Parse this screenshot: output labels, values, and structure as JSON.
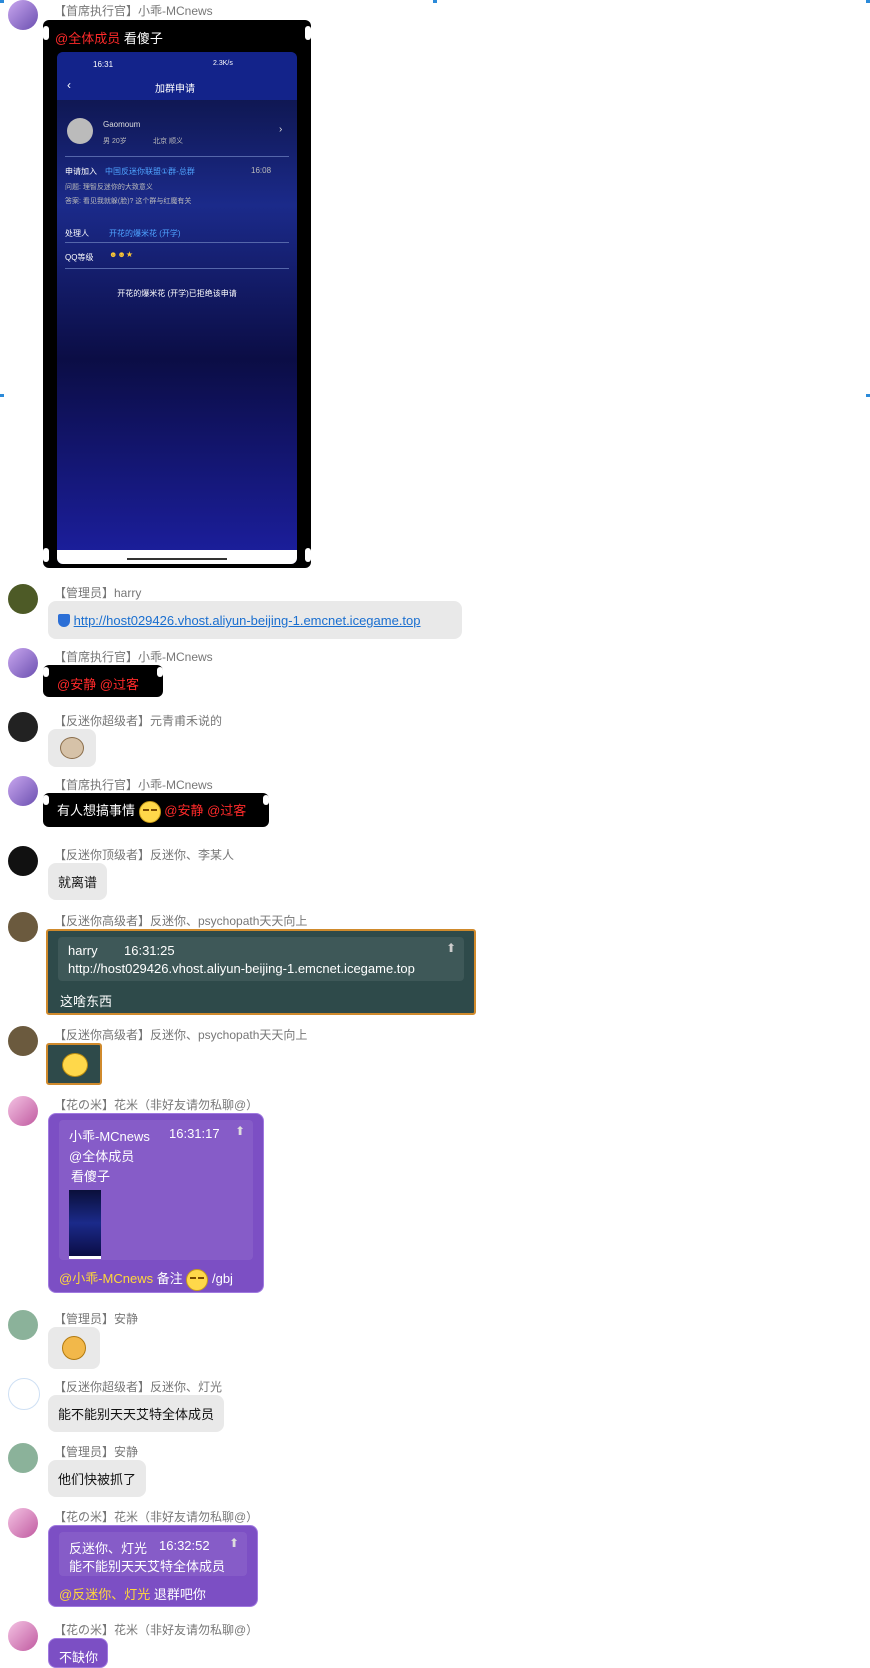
{
  "messages": [
    {
      "id": "m1",
      "sender": "【首席执行官】小乖-MCnews",
      "at": "@全体成员",
      "text": "看傻子",
      "phone": {
        "time": "16:31",
        "status": "2.3K/s",
        "title": "加群申请",
        "user": "Gaomoum",
        "sub1": "男 20岁",
        "sub2": "北京 顺义",
        "apply_label": "申请加入",
        "apply_group": "中国反迷你联盟①群-总群",
        "apply_time": "16:08",
        "question": "问题: 理智反迷你的大致意义",
        "answer": "答案: 看见我就躲(脸)? 这个群与红魔有关",
        "handler_label": "处理人",
        "handler": "开花的爆米花 (开学)",
        "level_label": "QQ等级",
        "level_icons": "☻☻★",
        "result": "开花的爆米花 (开学)已拒绝该申请"
      }
    },
    {
      "id": "m2",
      "sender": "【管理员】harry",
      "link": "http://host029426.vhost.aliyun-beijing-1.emcnet.icegame.top"
    },
    {
      "id": "m3",
      "sender": "【首席执行官】小乖-MCnews",
      "text": "@安静 @过客"
    },
    {
      "id": "m4",
      "sender": "【反迷你超级者】元青甫禾说的",
      "sticker": "cow-face-icon"
    },
    {
      "id": "m5",
      "sender": "【首席执行官】小乖-MCnews",
      "text": "有人想搞事情",
      "ats": "@安静 @过客"
    },
    {
      "id": "m6",
      "sender": "【反迷你顶级者】反迷你、李某人",
      "text": "就离谱"
    },
    {
      "id": "m7",
      "sender": "【反迷你高级者】反迷你、psychopath天天向上",
      "quote": {
        "author": "harry",
        "time": "16:31:25",
        "text": "http://host029426.vhost.aliyun-beijing-1.emcnet.icegame.top"
      },
      "text": "这啥东西"
    },
    {
      "id": "m8",
      "sender": "【反迷你高级者】反迷你、psychopath天天向上",
      "sticker": "surprised-face-icon"
    },
    {
      "id": "m9",
      "sender": "【花の米】花米（非好友请勿私聊@）",
      "quote": {
        "author": "小乖-MCnews",
        "time": "16:31:17",
        "line1": "@全体成员",
        "line2": "看傻子"
      },
      "at": "@小乖-MCnews",
      "text": "备注",
      "suffix": "/gbj"
    },
    {
      "id": "m10",
      "sender": "【管理员】安静",
      "sticker": "dog-face-icon"
    },
    {
      "id": "m11",
      "sender": "【反迷你超级者】反迷你、灯光",
      "text": "能不能别天天艾特全体成员"
    },
    {
      "id": "m12",
      "sender": "【管理员】安静",
      "text": "他们快被抓了"
    },
    {
      "id": "m13",
      "sender": "【花の米】花米（非好友请勿私聊@）",
      "quote": {
        "author": "反迷你、灯光",
        "time": "16:32:52",
        "text": "能不能别天天艾特全体成员"
      },
      "at": "@反迷你、灯光",
      "text": "退群吧你"
    },
    {
      "id": "m14",
      "sender": "【花の米】花米（非好友请勿私聊@）",
      "text": "不缺你"
    }
  ],
  "colors": {
    "link": "#1a6fd0",
    "bubble": "#e9e9e9",
    "purple": "#7c4fc4",
    "teal": "#2e4a4a",
    "orange_border": "#d08a2c"
  }
}
